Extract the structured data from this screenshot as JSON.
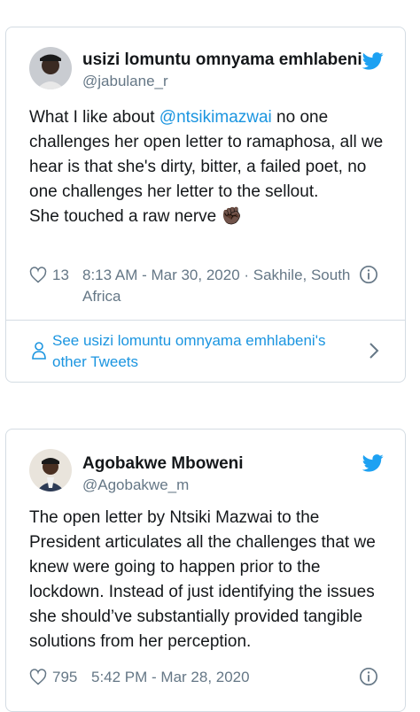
{
  "tweet1": {
    "author_name": "usizi lomuntu omnyama emhlabeni",
    "handle": "@jabulane_r",
    "text_prefix": "What I like about ",
    "mention": "@ntsikimazwai",
    "text_rest": " no one challenges her open letter to ramaphosa, all we hear is that  she's dirty, bitter, a failed poet, no one challenges her letter to the sellout.",
    "text_line2": "She touched a raw nerve",
    "emoji": "✊🏿",
    "likes": "13",
    "meta": "8:13 AM - Mar 30, 2020 · Sakhile, South Africa",
    "see_more": "See usizi lomuntu omnyama emhlabeni's other Tweets"
  },
  "tweet2": {
    "author_name": "Agobakwe Mboweni",
    "handle": "@Agobakwe_m",
    "text": "The open letter by Ntsiki Mazwai to the President articulates all the challenges that we knew were going to happen prior to the lockdown. Instead of just identifying the issues she should’ve substantially provided tangible solutions from her perception.",
    "likes": "795",
    "meta": "5:42 PM - Mar 28, 2020"
  },
  "colors": {
    "link": "#1b95e0",
    "secondary": "#657786",
    "border": "#d4dce3",
    "twitter_blue": "#1da1f2"
  }
}
